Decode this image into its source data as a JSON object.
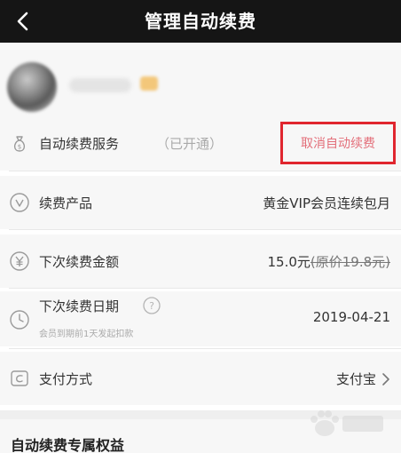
{
  "header": {
    "title": "管理自动续费"
  },
  "service": {
    "label": "自动续费服务",
    "status": "（已开通）",
    "cancel_label": "取消自动续费"
  },
  "rows": {
    "product": {
      "label": "续费产品",
      "value": "黄金VIP会员连续包月"
    },
    "amount": {
      "label": "下次续费金额",
      "value": "15.0元",
      "original": "(原价19.8元)"
    },
    "date": {
      "label": "下次续费日期",
      "note": "会员到期前1天发起扣款",
      "value": "2019-04-21"
    },
    "payment": {
      "label": "支付方式",
      "value": "支付宝"
    }
  },
  "benefits": {
    "title": "自动续费专属权益"
  },
  "icons": {
    "back": "chevron-left-icon",
    "service": "money-bag-icon",
    "product": "vip-v-icon",
    "amount": "yen-icon",
    "date": "clock-icon",
    "help": "question-icon",
    "payment": "card-icon",
    "arrow": "chevron-right-icon"
  },
  "colors": {
    "navbar": "#151515",
    "highlight_border": "#e0262f",
    "cancel_text": "#e36f7a"
  }
}
